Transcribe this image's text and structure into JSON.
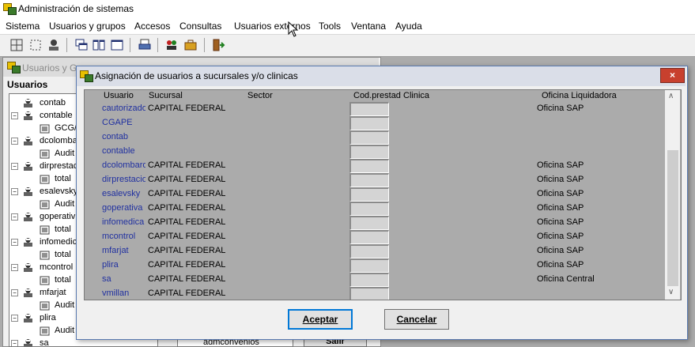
{
  "app": {
    "title": "Administración de sistemas"
  },
  "menu": [
    "Sistema",
    "Usuarios y grupos",
    "Accesos",
    "Consultas",
    "Usuarios externos",
    "Tools",
    "Ventana",
    "Ayuda"
  ],
  "bgwindow": {
    "title": "Usuarios y Gr",
    "section_label": "Usuarios",
    "tree": [
      {
        "label": "contab",
        "level": 1,
        "expander": ""
      },
      {
        "label": "contable",
        "level": 1,
        "expander": "−"
      },
      {
        "label": "GCG/",
        "level": 2,
        "expander": ""
      },
      {
        "label": "dcolomba",
        "level": 1,
        "expander": "−"
      },
      {
        "label": "Audit",
        "level": 2,
        "expander": ""
      },
      {
        "label": "dirprestac",
        "level": 1,
        "expander": "−"
      },
      {
        "label": "total",
        "level": 2,
        "expander": ""
      },
      {
        "label": "esalevsky",
        "level": 1,
        "expander": "−"
      },
      {
        "label": "Audit",
        "level": 2,
        "expander": ""
      },
      {
        "label": "goperativ",
        "level": 1,
        "expander": "−"
      },
      {
        "label": "total",
        "level": 2,
        "expander": ""
      },
      {
        "label": "infomedic",
        "level": 1,
        "expander": "−"
      },
      {
        "label": "total",
        "level": 2,
        "expander": ""
      },
      {
        "label": "mcontrol",
        "level": 1,
        "expander": "−"
      },
      {
        "label": "total",
        "level": 2,
        "expander": ""
      },
      {
        "label": "mfarjat",
        "level": 1,
        "expander": "−"
      },
      {
        "label": "Audit",
        "level": 2,
        "expander": ""
      },
      {
        "label": "plira",
        "level": 1,
        "expander": "−"
      },
      {
        "label": "Audit",
        "level": 2,
        "expander": ""
      },
      {
        "label": "sa",
        "level": 1,
        "expander": "−"
      }
    ],
    "bottom_item": "admconvenios",
    "exit_button": "Salir"
  },
  "dialog": {
    "title": "Asignación de usuarios a sucursales y/o clinicas",
    "columns": {
      "usuario": "Usuario",
      "sucursal": "Sucursal",
      "sector": "Sector",
      "codprestad": "Cod.prestad",
      "clinica": "Clinica",
      "oficina": "Oficina Liquidadora"
    },
    "rows": [
      {
        "usuario": "cautorizado",
        "sucursal": "CAPITAL FEDERAL",
        "oficina": "Oficina SAP"
      },
      {
        "usuario": "CGAPE",
        "sucursal": "",
        "oficina": ""
      },
      {
        "usuario": "contab",
        "sucursal": "",
        "oficina": ""
      },
      {
        "usuario": "contable",
        "sucursal": "",
        "oficina": ""
      },
      {
        "usuario": "dcolombaro",
        "sucursal": "CAPITAL FEDERAL",
        "oficina": "Oficina SAP"
      },
      {
        "usuario": "dirprestacio",
        "sucursal": "CAPITAL FEDERAL",
        "oficina": "Oficina SAP"
      },
      {
        "usuario": "esalevsky",
        "sucursal": "CAPITAL FEDERAL",
        "oficina": "Oficina SAP"
      },
      {
        "usuario": "goperativa",
        "sucursal": "CAPITAL FEDERAL",
        "oficina": "Oficina SAP"
      },
      {
        "usuario": "infomedica",
        "sucursal": "CAPITAL FEDERAL",
        "oficina": "Oficina SAP"
      },
      {
        "usuario": "mcontrol",
        "sucursal": "CAPITAL FEDERAL",
        "oficina": "Oficina SAP"
      },
      {
        "usuario": "mfarjat",
        "sucursal": "CAPITAL FEDERAL",
        "oficina": "Oficina SAP"
      },
      {
        "usuario": "plira",
        "sucursal": "CAPITAL FEDERAL",
        "oficina": "Oficina SAP"
      },
      {
        "usuario": "sa",
        "sucursal": "CAPITAL FEDERAL",
        "oficina": "Oficina Central"
      },
      {
        "usuario": "vmillan",
        "sucursal": "CAPITAL FEDERAL",
        "oficina": ""
      }
    ],
    "accept_button": "Aceptar",
    "cancel_button": "Cancelar",
    "close_glyph": "×"
  },
  "icons": {
    "app": "app-icon",
    "tree_user": "user-group-icon",
    "tree_item": "grid-item-icon"
  }
}
